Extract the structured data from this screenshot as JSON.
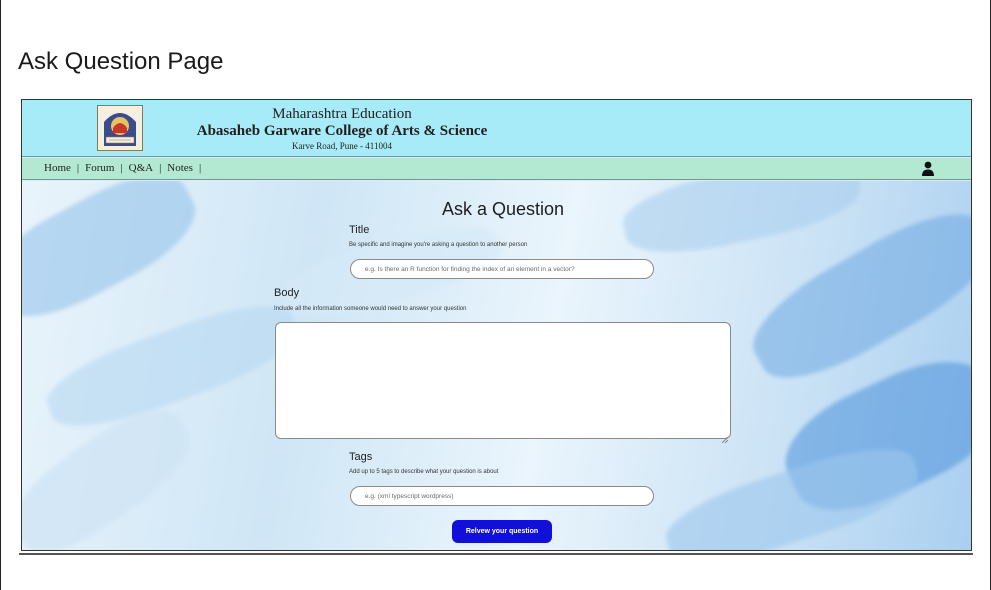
{
  "slide": {
    "title": "Ask Question Page"
  },
  "header": {
    "line1": "Maharashtra Education",
    "line2": "Abasaheb Garware College of Arts & Science",
    "line3": "Karve Road, Pune - 411004"
  },
  "nav": {
    "items": [
      {
        "label": "Home"
      },
      {
        "label": "Forum"
      },
      {
        "label": "Q&A"
      },
      {
        "label": "Notes"
      }
    ],
    "separator": "|"
  },
  "form": {
    "heading": "Ask a Question",
    "title_label": "Title",
    "title_hint": "Be specific and imagine you're asking a question to another person",
    "title_placeholder": "e.g. Is there an R function for finding the index of an element in a vector?",
    "body_label": "Body",
    "body_hint": "Include all the information someone would need to answer your question",
    "tags_label": "Tags",
    "tags_hint": "Add up to 5 tags to describe what your question is about",
    "tags_placeholder": "e.g. (xml typescript wordpress)",
    "submit_label": "Relvew your question"
  },
  "colors": {
    "header_bg": "#a8ebf8",
    "nav_bg": "#b3e8d2",
    "submit_bg": "#1010d8"
  },
  "icons": {
    "user": "user-icon",
    "logo": "college-logo"
  }
}
